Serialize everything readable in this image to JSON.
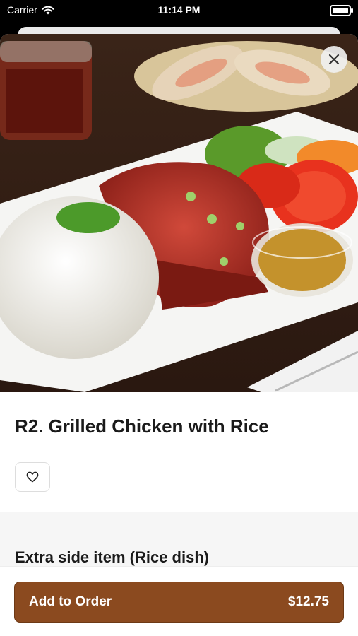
{
  "status_bar": {
    "carrier": "Carrier",
    "time": "11:14 PM"
  },
  "item": {
    "title": "R2. Grilled Chicken with Rice",
    "image_alt": "Grilled chicken with rice, scallions, tomato, lettuce and dipping sauce"
  },
  "section": {
    "title": "Extra side item (Rice dish)"
  },
  "footer": {
    "add_label": "Add to Order",
    "price": "$12.75"
  },
  "colors": {
    "accent": "#8b4a1f"
  },
  "icons": {
    "close": "close-icon",
    "favorite": "heart-icon",
    "wifi": "wifi-icon",
    "battery": "battery-icon"
  }
}
